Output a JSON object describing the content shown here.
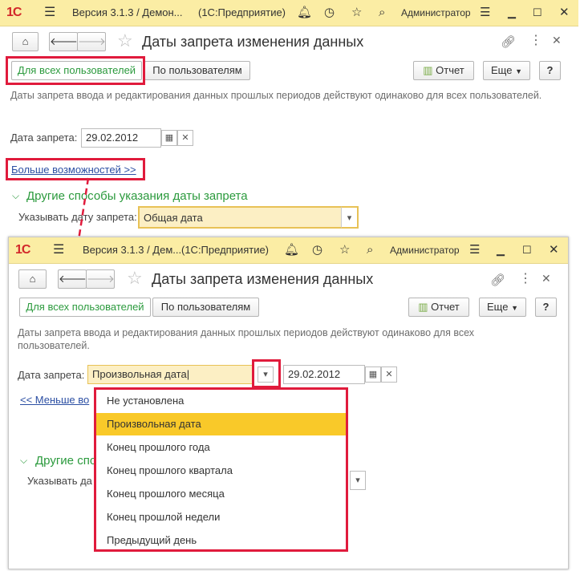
{
  "titlebar_back": {
    "title": "Версия 3.1.3 / Демон...",
    "app": "(1С:Предприятие)",
    "user": "Администратор"
  },
  "titlebar_front": {
    "title": "Версия 3.1.3 / Дем...",
    "app": "(1С:Предприятие)",
    "user": "Администратор"
  },
  "logo": "1С",
  "page": {
    "title": "Даты запрета изменения данных",
    "tab_all": "Для всех пользователей",
    "tab_users": "По пользователям",
    "report": "Отчет",
    "more": "Еще",
    "help": "?",
    "hint_back": "Даты запрета ввода и редактирования данных прошлых периодов действуют одинаково для всех пользователей.",
    "hint_front_1": "Даты запрета ввода и редактирования данных прошлых периодов действуют одинаково для всех",
    "hint_front_2": "пользователей."
  },
  "back_form": {
    "date_label": "Дата запрета:",
    "date_value": "29.02.2012",
    "more_link": "Больше возможностей >>",
    "section": "Другие способы указания даты запрета",
    "specify_label": "Указывать дату запрета:",
    "specify_value": "Общая дата"
  },
  "front_form": {
    "date_label": "Дата запрета:",
    "kind_value": "Произвольная дата",
    "date_value": "29.02.2012",
    "less_link": "<< Меньше во",
    "section": "Другие спо",
    "specify_label": "Указывать да"
  },
  "dropdown": {
    "items": [
      "Не установлена",
      "Произвольная дата",
      "Конец прошлого года",
      "Конец прошлого квартала",
      "Конец прошлого месяца",
      "Конец прошлой недели",
      "Предыдущий день"
    ],
    "selected_index": 1
  },
  "colors": {
    "accent_green": "#2b9a3d",
    "highlight_red": "#e01b3c",
    "titlebar": "#fbeda4",
    "selected": "#f9c929"
  }
}
